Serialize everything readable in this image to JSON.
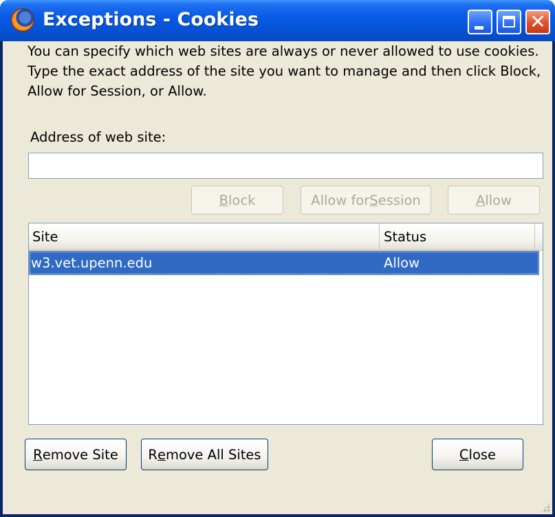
{
  "window": {
    "title": "Exceptions - Cookies",
    "icon": "firefox-icon"
  },
  "intro": {
    "line1": "You can specify which web sites are always or never allowed to use cookies.",
    "line2": "Type the exact address of the site you want to manage and then click Block,",
    "line3": "Allow for Session, or Allow."
  },
  "address": {
    "label": "Address of web site:",
    "value": "",
    "placeholder": ""
  },
  "buttons": {
    "block": {
      "pre": "",
      "key": "B",
      "post": "lock"
    },
    "allow_session": {
      "pre": "Allow for ",
      "key": "S",
      "post": "ession"
    },
    "allow": {
      "pre": "",
      "key": "A",
      "post": "llow"
    },
    "remove_site": {
      "pre": "",
      "key": "R",
      "post": "emove Site"
    },
    "remove_all": {
      "pre": "R",
      "key": "e",
      "post": "move All Sites"
    },
    "close": {
      "pre": "",
      "key": "C",
      "post": "lose"
    }
  },
  "table": {
    "columns": [
      "Site",
      "Status"
    ],
    "rows": [
      {
        "site": "w3.vet.upenn.edu",
        "status": "Allow",
        "selected": true
      }
    ]
  },
  "colors": {
    "selection": "#316ac5",
    "titlebar": "#0653d6",
    "dialog_bg": "#ece9d8"
  }
}
